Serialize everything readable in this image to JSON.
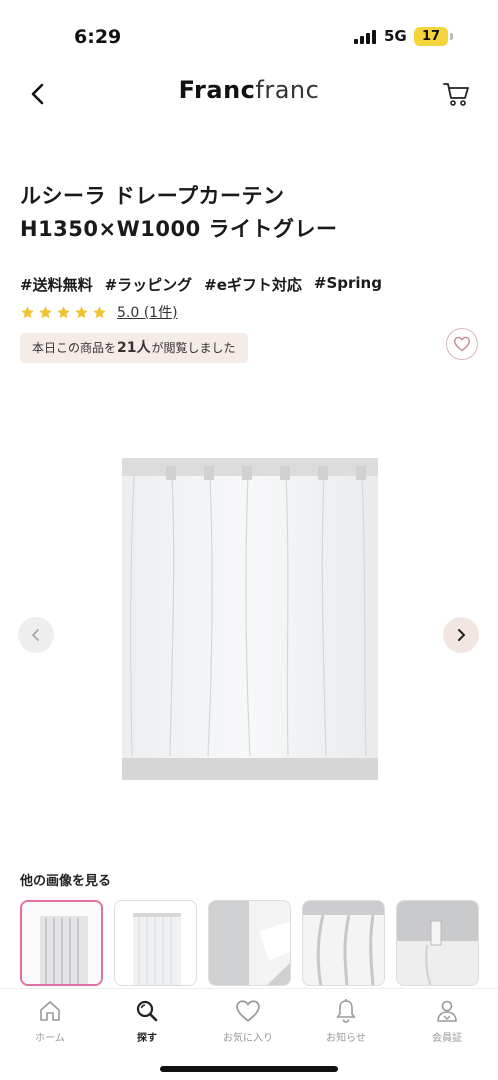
{
  "status_bar": {
    "time": "6:29",
    "network": "5G",
    "battery": "17"
  },
  "header": {
    "logo_bold": "Franc",
    "logo_light": "franc",
    "back_icon": "chevron-left-icon",
    "cart_icon": "cart-icon"
  },
  "product": {
    "title_line1": "ルシーラ ドレープカーテン",
    "title_line2": "H1350×W1000 ライトグレー",
    "tags": [
      "#送料無料",
      "#ラッピング",
      "#eギフト対応",
      "#Spring"
    ],
    "rating_stars": 5,
    "rating_text": "5.0 (1件)",
    "views_prefix": "本日この商品を",
    "views_count": "21人",
    "views_suffix": "が閲覧しました"
  },
  "gallery": {
    "other_images_label": "他の画像を見る",
    "thumbnail_count": 5,
    "active_index": 0
  },
  "bottom_nav": [
    {
      "label": "ホーム",
      "icon": "home-icon",
      "active": false
    },
    {
      "label": "探す",
      "icon": "search-icon",
      "active": true
    },
    {
      "label": "お気に入り",
      "icon": "heart-icon",
      "active": false
    },
    {
      "label": "お知らせ",
      "icon": "bell-icon",
      "active": false
    },
    {
      "label": "会員証",
      "icon": "member-icon",
      "active": false
    }
  ],
  "colors": {
    "accent_pink": "#e56fa3",
    "badge_bg": "#f5ece8",
    "star": "#f2c12e"
  }
}
